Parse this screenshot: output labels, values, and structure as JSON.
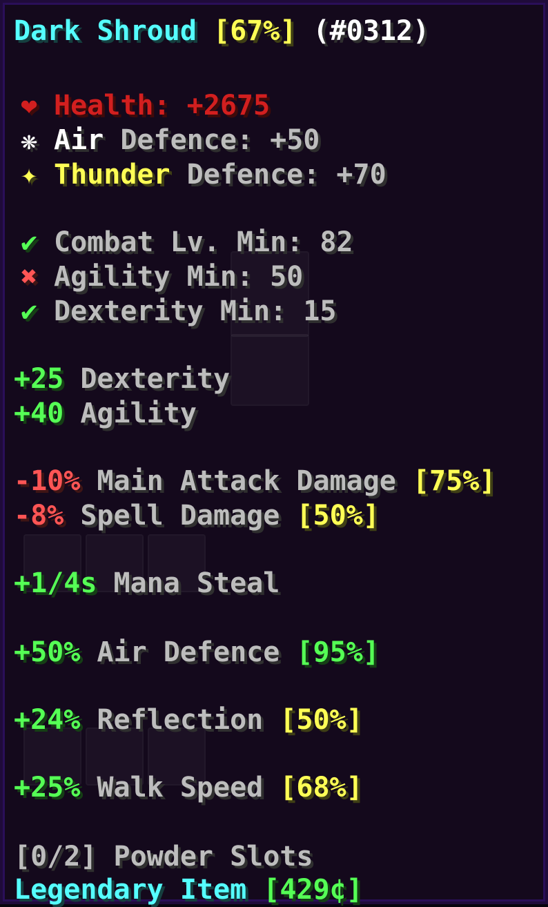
{
  "header": {
    "name": "Dark Shroud",
    "quality": "[67%]",
    "id": "(#0312)"
  },
  "base_stats": [
    {
      "icon": "heart-icon",
      "glyph": "❤",
      "element": "Health",
      "rest": ": +2675",
      "color": "#d21f1f"
    },
    {
      "icon": "air-icon",
      "glyph": "❋",
      "element": "Air",
      "rest": " Defence: +50",
      "color": "#ffffff"
    },
    {
      "icon": "thunder-icon",
      "glyph": "✦",
      "element": "Thunder",
      "rest": " Defence: +70",
      "color": "#ffff55"
    }
  ],
  "requirements": [
    {
      "icon": "check-icon",
      "glyph": "✔",
      "text": "Combat Lv. Min: 82",
      "met": true
    },
    {
      "icon": "cross-icon",
      "glyph": "✖",
      "text": "Agility Min: 50",
      "met": false
    },
    {
      "icon": "check-icon",
      "glyph": "✔",
      "text": "Dexterity Min: 15",
      "met": true
    }
  ],
  "skill_bonuses": [
    {
      "value": "+25",
      "name": " Dexterity"
    },
    {
      "value": "+40",
      "name": " Agility"
    }
  ],
  "identifications": [
    {
      "value": "-10%",
      "name": " Main Attack Damage ",
      "roll": "[75%]",
      "value_color": "#ff5555",
      "roll_color": "#ffff55"
    },
    {
      "value": "-8%",
      "name": " Spell Damage ",
      "roll": "[50%]",
      "value_color": "#ff5555",
      "roll_color": "#ffff55"
    },
    {
      "value": "+1/4s",
      "name": " Mana Steal",
      "roll": "",
      "value_color": "#55ff55",
      "roll_color": "#ffff55"
    },
    {
      "value": "+50%",
      "name": " Air Defence ",
      "roll": "[95%]",
      "value_color": "#55ff55",
      "roll_color": "#55ff55"
    },
    {
      "value": "+24%",
      "name": " Reflection ",
      "roll": "[50%]",
      "value_color": "#55ff55",
      "roll_color": "#ffff55"
    },
    {
      "value": "+25%",
      "name": " Walk Speed ",
      "roll": "[68%]",
      "value_color": "#55ff55",
      "roll_color": "#ffff55"
    }
  ],
  "footer": {
    "powder_slots": "[0/2] Powder Slots",
    "rarity": "Legendary Item",
    "price": "[429¢]"
  },
  "colors": {
    "aqua": "#55ffff",
    "yellow": "#ffff55",
    "green": "#55ff55",
    "light_red": "#ff5555",
    "red": "#d21f1f",
    "gray": "#bdbdbd",
    "border": "#2a0f58",
    "background": "#14091c"
  }
}
